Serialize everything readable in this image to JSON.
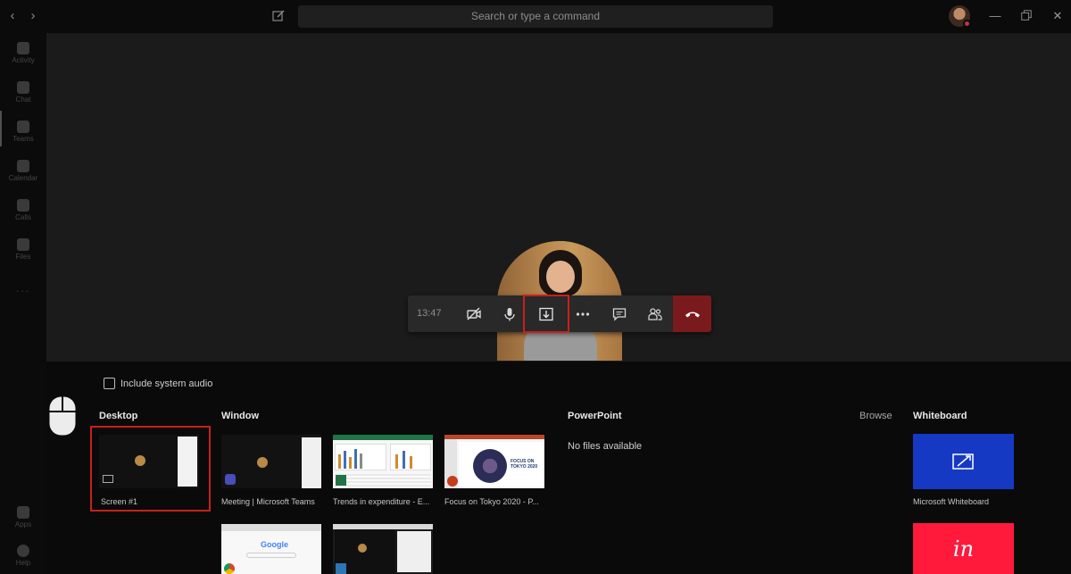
{
  "titlebar": {
    "search_placeholder": "Search or type a command"
  },
  "rail": {
    "items": [
      {
        "label": "Activity",
        "icon": "bell-icon"
      },
      {
        "label": "Chat",
        "icon": "chat-icon"
      },
      {
        "label": "Teams",
        "icon": "teams-icon"
      },
      {
        "label": "Calendar",
        "icon": "calendar-icon"
      },
      {
        "label": "Calls",
        "icon": "phone-icon"
      },
      {
        "label": "Files",
        "icon": "file-icon"
      }
    ],
    "more": "...",
    "bottom": [
      {
        "label": "Apps",
        "icon": "apps-icon"
      },
      {
        "label": "Help",
        "icon": "help-icon"
      }
    ]
  },
  "call": {
    "timer": "13:47"
  },
  "share": {
    "include_audio_label": "Include system audio",
    "sections": {
      "desktop": "Desktop",
      "window": "Window",
      "powerpoint": "PowerPoint",
      "browse": "Browse",
      "whiteboard": "Whiteboard"
    },
    "desktop_items": [
      {
        "label": "Screen #1"
      }
    ],
    "window_items": [
      {
        "label": "Meeting | Microsoft Teams"
      },
      {
        "label": "Trends in expenditure - E..."
      },
      {
        "label": "Focus on Tokyo 2020 - P..."
      },
      {
        "label": ""
      },
      {
        "label": ""
      }
    ],
    "powerpoint_empty": "No files available",
    "whiteboard_items": [
      {
        "label": "Microsoft Whiteboard",
        "color": "#1639c4"
      },
      {
        "label": "",
        "color": "#ff1a3c"
      }
    ],
    "ppt_thumb_title": "FOCUS ON TOKYO 2020",
    "google_text": "Google",
    "invision_text": "in"
  },
  "colors": {
    "highlight": "#c8201c",
    "hangup": "#7a1a1c"
  }
}
